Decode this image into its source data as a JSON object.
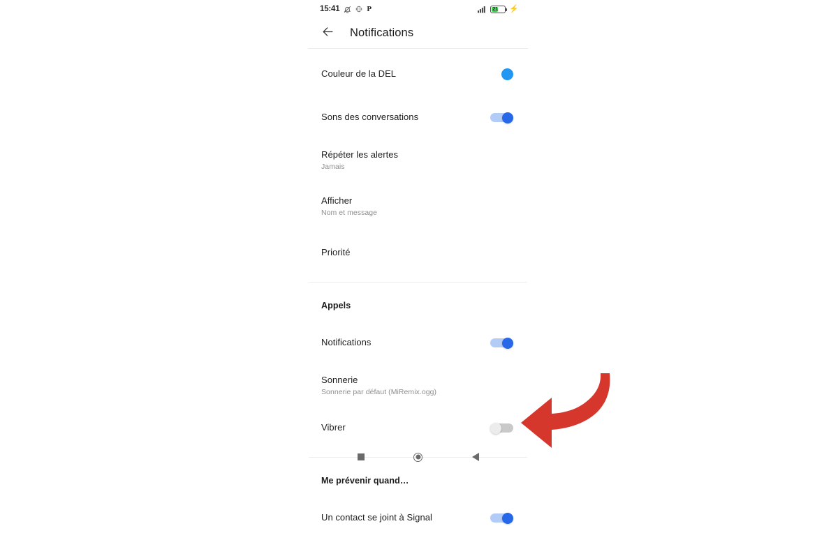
{
  "status_bar": {
    "time": "15:41",
    "icons_left": [
      "bell-muted-icon",
      "vibrate-icon",
      "p-mode-icon"
    ],
    "p_label": "P",
    "signal_icon": "signal-bars-icon",
    "battery_percent": "21",
    "battery_fill_color": "#3ddc4e",
    "charging_icon": "charging-bolt-icon"
  },
  "app_bar": {
    "back_icon": "back-arrow-icon",
    "title": "Notifications"
  },
  "sections": [
    {
      "header": null,
      "rows": [
        {
          "title": "Couleur de la DEL",
          "subtitle": null,
          "control": "color-swatch",
          "color": "#2196f3"
        },
        {
          "title": "Sons des conversations",
          "subtitle": null,
          "control": "toggle",
          "state": "on"
        },
        {
          "title": "Répéter les alertes",
          "subtitle": "Jamais",
          "control": "none"
        },
        {
          "title": "Afficher",
          "subtitle": "Nom et message",
          "control": "none"
        },
        {
          "title": "Priorité",
          "subtitle": null,
          "control": "none"
        }
      ]
    },
    {
      "header": "Appels",
      "rows": [
        {
          "title": "Notifications",
          "subtitle": null,
          "control": "toggle",
          "state": "on"
        },
        {
          "title": "Sonnerie",
          "subtitle": "Sonnerie par défaut (MiRemix.ogg)",
          "control": "none"
        },
        {
          "title": "Vibrer",
          "subtitle": null,
          "control": "toggle",
          "state": "off"
        }
      ]
    },
    {
      "header": "Me prévenir quand…",
      "rows": [
        {
          "title": "Un contact se joint à Signal",
          "subtitle": null,
          "control": "toggle",
          "state": "on"
        }
      ]
    }
  ],
  "nav_bar": {
    "recents": "recents-square-icon",
    "home": "home-circle-icon",
    "back": "back-triangle-icon"
  },
  "annotation": {
    "shape": "curved-arrow-left",
    "color": "#d6372c"
  },
  "theme": {
    "toggle_on_track": "#b3ccf7",
    "toggle_on_knob": "#2768e8",
    "toggle_off_track": "#c9c9c9",
    "toggle_off_knob": "#ececec",
    "divider": "#ededee",
    "text_primary": "#1e1e1e",
    "text_secondary": "#8d8d8d"
  }
}
